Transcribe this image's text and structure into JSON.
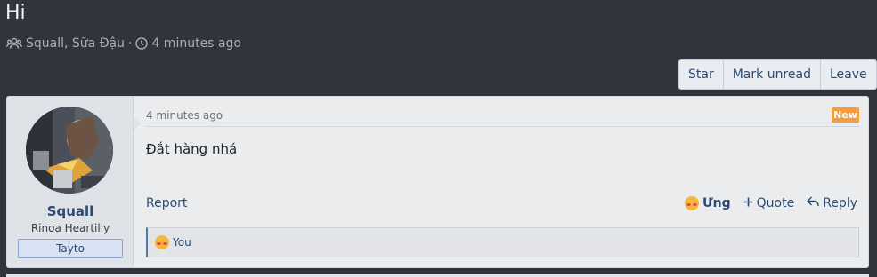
{
  "thread": {
    "title": "Hi",
    "participants": "Squall, Sữa Đậu",
    "separator": "·",
    "time_ago": "4 minutes ago"
  },
  "toolbar": {
    "star_label": "Star",
    "mark_unread_label": "Mark unread",
    "leave_label": "Leave"
  },
  "message": {
    "username": "Squall",
    "user_title": "Rinoa Heartilly",
    "user_banner": "Tayto",
    "time": "4 minutes ago",
    "badge": "New",
    "body": "Đắt hàng nhá",
    "report_label": "Report",
    "reaction_label": "Ưng",
    "quote_label": "Quote",
    "reply_label": "Reply",
    "reacted_by": "You"
  },
  "colors": {
    "background": "#30353d",
    "link": "#2d4a73",
    "new_badge": "#f39d3f"
  },
  "icons": {
    "participants": "users-icon",
    "time": "clock-icon",
    "reaction": "love-emoji-icon",
    "quote": "plus-icon",
    "reply": "reply-arrow-icon"
  }
}
